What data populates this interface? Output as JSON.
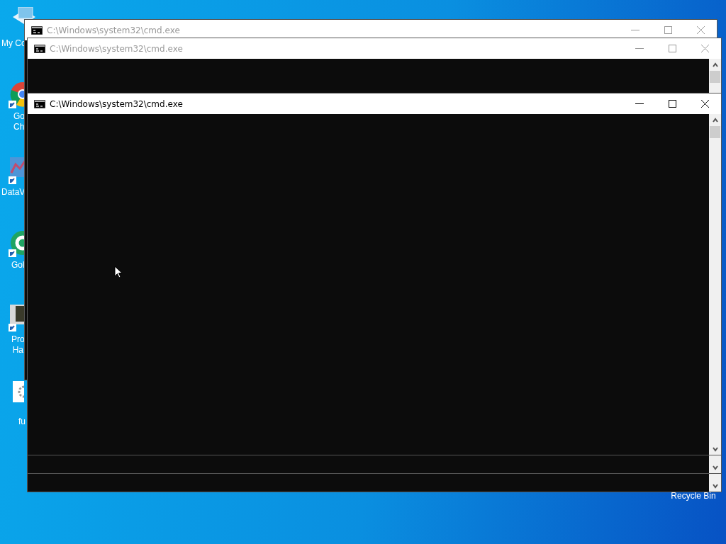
{
  "desktop": {
    "icons": [
      {
        "kind": "computer",
        "label": [
          "My Co"
        ]
      },
      {
        "kind": "browser",
        "label": [
          "Go",
          "Ch"
        ]
      },
      {
        "kind": "chart",
        "label": [
          "DataV"
        ]
      },
      {
        "kind": "letter-app",
        "label": [
          "Gol"
        ]
      },
      {
        "kind": "device",
        "label": [
          "Pro",
          "Ha"
        ]
      },
      {
        "kind": "settings-file",
        "label": [
          "fu"
        ]
      },
      {
        "kind": "recycle",
        "label": [
          "Recycle Bin"
        ]
      }
    ]
  },
  "windows": [
    {
      "title": "C:\\Windows\\system32\\cmd.exe",
      "active": false
    },
    {
      "title": "C:\\Windows\\system32\\cmd.exe",
      "active": false
    },
    {
      "title": "C:\\Windows\\system32\\cmd.exe",
      "active": true
    },
    {
      "kind": "covered"
    }
  ]
}
